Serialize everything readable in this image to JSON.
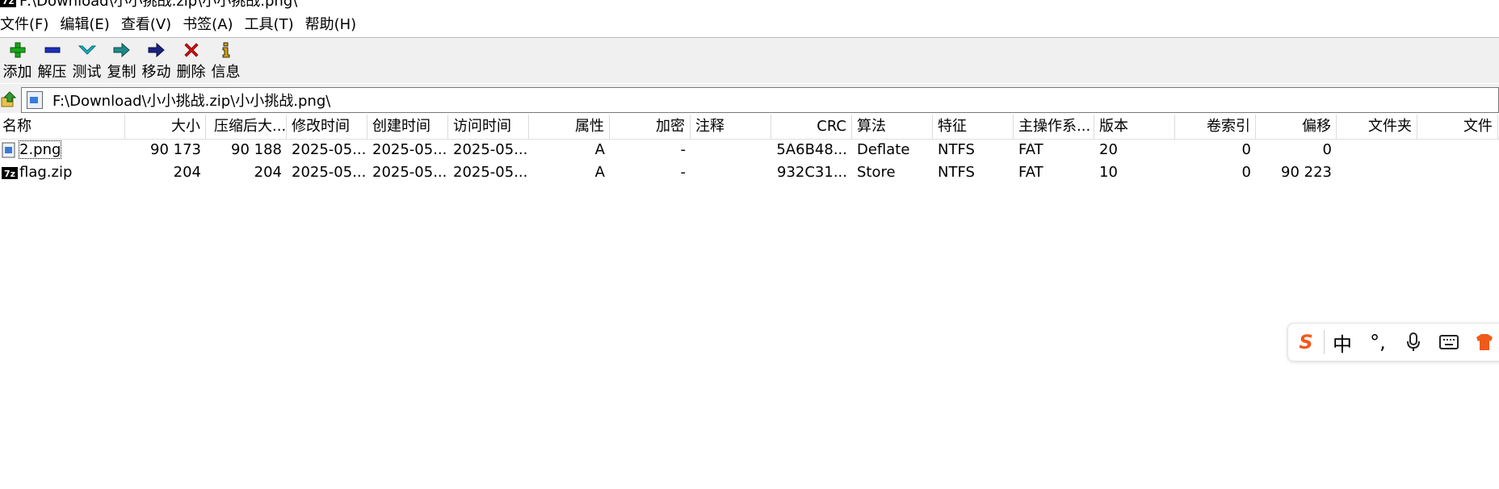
{
  "window": {
    "title": "F:\\Download\\小小挑战.zip\\小小挑战.png\\",
    "app_logo_text": "7z"
  },
  "menu": [
    {
      "label": "文件(F)"
    },
    {
      "label": "编辑(E)"
    },
    {
      "label": "查看(V)"
    },
    {
      "label": "书签(A)"
    },
    {
      "label": "工具(T)"
    },
    {
      "label": "帮助(H)"
    }
  ],
  "toolbar": [
    {
      "label": "添加",
      "icon": "plus-icon",
      "color": "#1aa61a"
    },
    {
      "label": "解压",
      "icon": "minus-icon",
      "color": "#1c2fb8"
    },
    {
      "label": "测试",
      "icon": "check-down-icon",
      "color": "#17b5c8"
    },
    {
      "label": "复制",
      "icon": "copy-arrow-icon",
      "color": "#1f8a8a"
    },
    {
      "label": "移动",
      "icon": "move-arrow-icon",
      "color": "#1a237e"
    },
    {
      "label": "删除",
      "icon": "delete-x-icon",
      "color": "#d01010"
    },
    {
      "label": "信息",
      "icon": "info-icon",
      "color": "#d8a400"
    }
  ],
  "address": {
    "path": "F:\\Download\\小小挑战.zip\\小小挑战.png\\"
  },
  "columns": [
    "名称",
    "大小",
    "压缩后大...",
    "修改时间",
    "创建时间",
    "访问时间",
    "属性",
    "加密",
    "注释",
    "CRC",
    "算法",
    "特征",
    "主操作系...",
    "版本",
    "卷索引",
    "偏移",
    "文件夹",
    "文件"
  ],
  "rows": [
    {
      "name": "2.png",
      "size": "90 173",
      "packed": "90 188",
      "mtime": "2025-05...",
      "ctime": "2025-05...",
      "atime": "2025-05...",
      "attr": "A",
      "enc": "-",
      "comment": "",
      "crc": "5A6B48...",
      "method": "Deflate",
      "char": "NTFS",
      "hostos": "FAT",
      "version": "20",
      "volume": "0",
      "offset": "0",
      "folders": "",
      "files": ""
    },
    {
      "name": "flag.zip",
      "size": "204",
      "packed": "204",
      "mtime": "2025-05...",
      "ctime": "2025-05...",
      "atime": "2025-05...",
      "attr": "A",
      "enc": "-",
      "comment": "",
      "crc": "932C31...",
      "method": "Store",
      "char": "NTFS",
      "hostos": "FAT",
      "version": "10",
      "volume": "0",
      "offset": "90 223",
      "folders": "",
      "files": ""
    }
  ],
  "ime": {
    "logo": "S",
    "mode": "中",
    "punct": "°,",
    "icons": [
      "sogou-logo-icon",
      "chinese-mode-icon",
      "punctuation-icon",
      "microphone-icon",
      "keyboard-icon",
      "skin-icon"
    ],
    "accent": "#f05a1a"
  }
}
